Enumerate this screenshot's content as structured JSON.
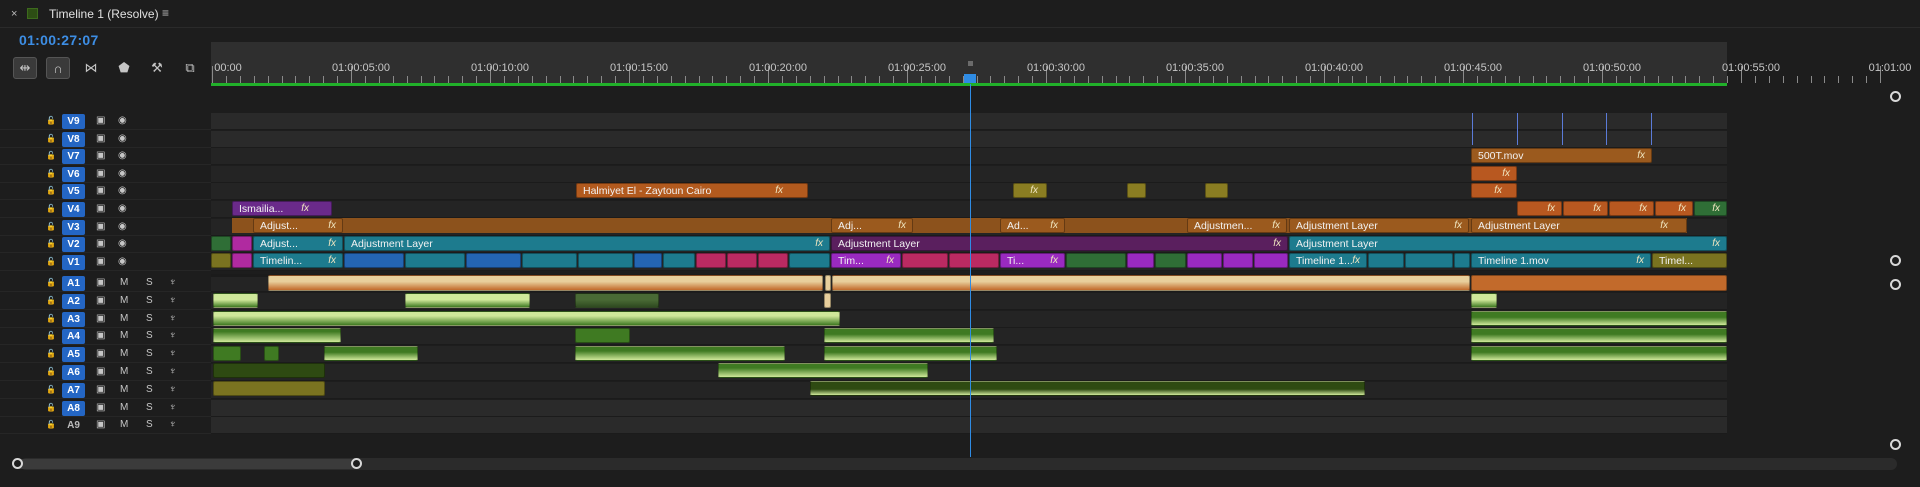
{
  "panel": {
    "close_icon": "×",
    "title": "Timeline 1 (Resolve)",
    "menu_icon": "≡",
    "timecode": "01:00:27:07"
  },
  "tools": [
    {
      "name": "insert-tool-icon",
      "glyph": "⇹",
      "active": true
    },
    {
      "name": "snap-magnet-icon",
      "glyph": "∩",
      "active": true
    },
    {
      "name": "linked-selection-icon",
      "glyph": "⋈",
      "active": false
    },
    {
      "name": "marker-icon",
      "glyph": "⬟",
      "active": false
    },
    {
      "name": "wrench-icon",
      "glyph": "⚒",
      "active": false
    },
    {
      "name": "captions-icon",
      "glyph": "⧉",
      "active": false
    }
  ],
  "ruler": {
    "labels": [
      "00:00",
      "01:00:05:00",
      "01:00:10:00",
      "01:00:15:00",
      "01:00:20:00",
      "01:00:25:00",
      "01:00:30:00",
      "01:00:35:00",
      "01:00:40:00",
      "01:00:45:00",
      "01:00:50:00",
      "01:00:55:00",
      "01:01:00"
    ]
  },
  "video_tracks": [
    "V9",
    "V8",
    "V7",
    "V6",
    "V5",
    "V4",
    "V3",
    "V2",
    "V1"
  ],
  "audio_tracks": [
    "A1",
    "A2",
    "A3",
    "A4",
    "A5",
    "A6",
    "A7",
    "A8",
    "A9"
  ],
  "audio_mute_label": "M",
  "audio_solo_label": "S",
  "colors": {
    "accent": "#2f8ce4",
    "adjustment_orange": "#9b5a1e",
    "teal": "#1d7b8e",
    "blue": "#2465b3",
    "purple": "#6a2a8a",
    "magenta": "#bb2a62",
    "green": "#2f6e36",
    "olive": "#7a7320",
    "audio_green": "#3f7a22",
    "audio_tan": "#e8cf9c",
    "audio_orange": "#c26a2b"
  },
  "clips": {
    "v7": [
      {
        "label": "500T.mov",
        "fx": "fx"
      }
    ],
    "v6": [
      {
        "label": "",
        "fx": "fx"
      }
    ],
    "v5": [
      {
        "label": "Halmiyet El - Zaytoun Cairo",
        "fx": "fx"
      },
      {
        "label": "",
        "fx": "fx"
      }
    ],
    "v4": [
      {
        "label": "Ismailia...",
        "fx": "fx"
      }
    ],
    "v3": [
      {
        "label": "Adjust...",
        "fx": "fx"
      },
      {
        "label": "Adj...",
        "fx": "fx"
      },
      {
        "label": "Ad...",
        "fx": "fx"
      },
      {
        "label": "Adjustmen...",
        "fx": "fx"
      },
      {
        "label": "Adjustment Layer",
        "fx": "fx"
      },
      {
        "label": "Adjustment Layer",
        "fx": "fx"
      }
    ],
    "v2": [
      {
        "label": "Adjust...",
        "fx": "fx"
      },
      {
        "label": "Adjustment Layer",
        "fx": "fx"
      },
      {
        "label": "Adjustment Layer",
        "fx": "fx"
      },
      {
        "label": "Adjustment Layer",
        "fx": "fx"
      }
    ],
    "v1": [
      {
        "label": "Timelin...",
        "fx": "fx"
      },
      {
        "label": "Tim...",
        "fx": "fx"
      },
      {
        "label": "Ti...",
        "fx": "fx"
      },
      {
        "label": "Timeline 1...",
        "fx": "fx"
      },
      {
        "label": "Timeline 1.mov",
        "fx": "fx"
      },
      {
        "label": "Timel...",
        "fx": "fx"
      }
    ]
  }
}
